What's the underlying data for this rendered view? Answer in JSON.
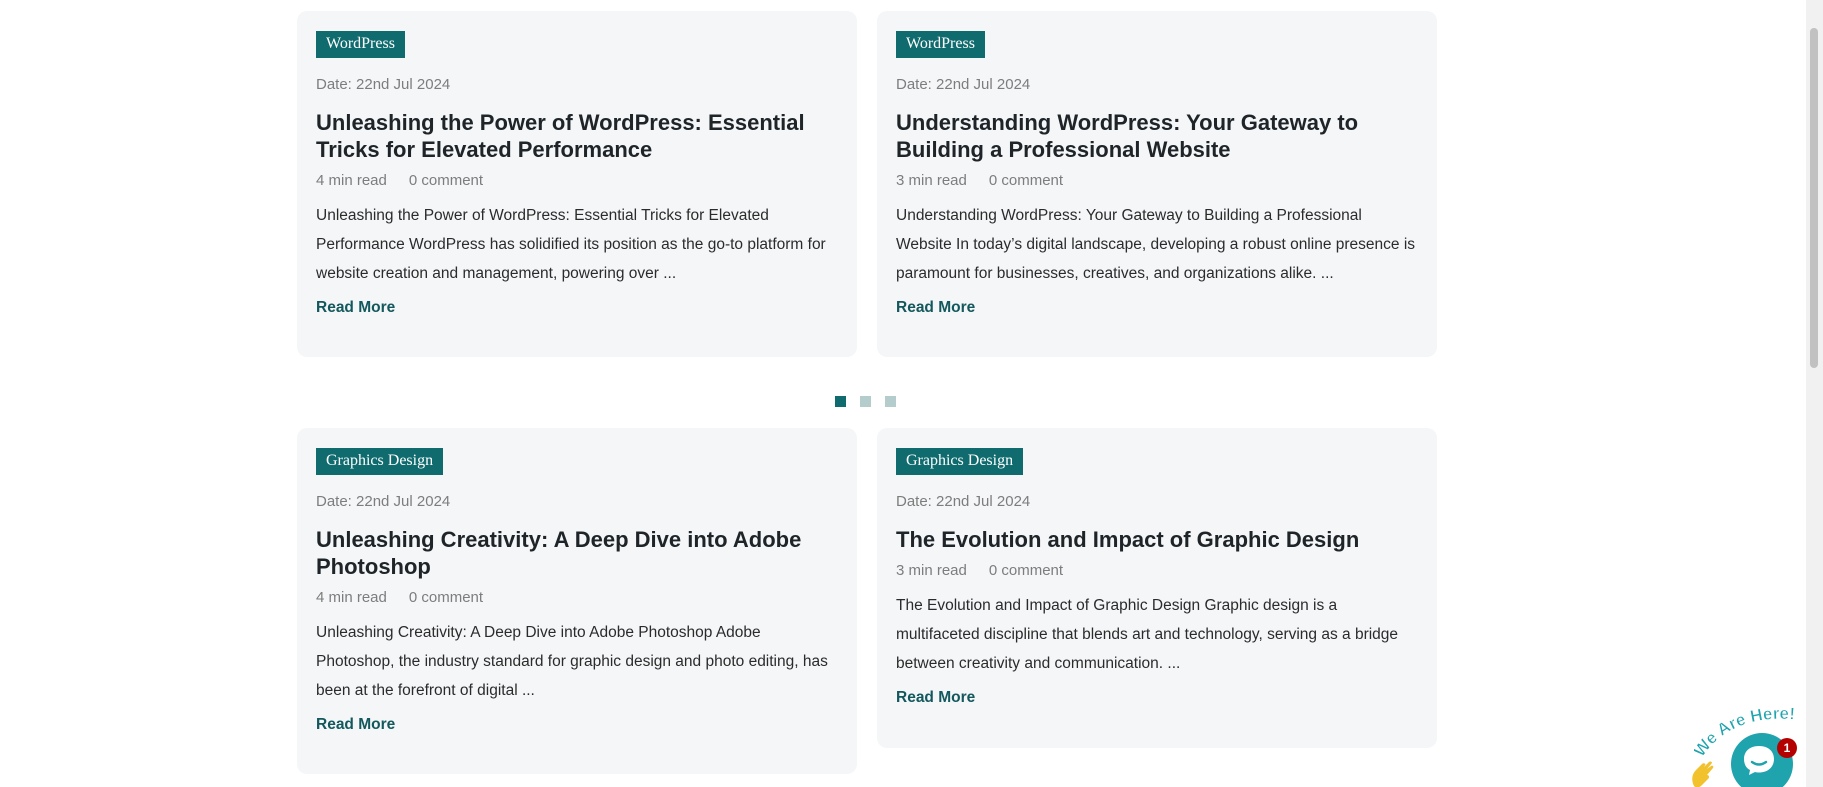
{
  "posts": [
    {
      "category": "WordPress",
      "date": "Date: 22nd Jul 2024",
      "title": "Unleashing the Power of WordPress: Essential Tricks for Elevated Performance",
      "read_time": "4 min read",
      "comments": "0 comment",
      "excerpt": "Unleashing the Power of WordPress: Essential Tricks for Elevated Performance WordPress has solidified its position as the go-to platform for website creation and management, powering over ...",
      "read_more": "Read More"
    },
    {
      "category": "WordPress",
      "date": "Date: 22nd Jul 2024",
      "title": "Understanding WordPress: Your Gateway to Building a Professional Website",
      "read_time": "3 min read",
      "comments": "0 comment",
      "excerpt": "Understanding WordPress: Your Gateway to Building a Professional Website In today’s digital landscape, developing a robust online presence is paramount for businesses, creatives, and organizations alike. ...",
      "read_more": "Read More"
    },
    {
      "category": "Graphics Design",
      "date": "Date: 22nd Jul 2024",
      "title": "Unleashing Creativity: A Deep Dive into Adobe Photoshop",
      "read_time": "4 min read",
      "comments": "0 comment",
      "excerpt": "Unleashing Creativity: A Deep Dive into Adobe Photoshop Adobe Photoshop, the industry standard for graphic design and photo editing, has been at the forefront of digital ...",
      "read_more": "Read More"
    },
    {
      "category": "Graphics Design",
      "date": "Date: 22nd Jul 2024",
      "title": "The Evolution and Impact of Graphic Design",
      "read_time": "3 min read",
      "comments": "0 comment",
      "excerpt": "The Evolution and Impact of Graphic Design Graphic design is a multifaceted discipline that blends art and technology, serving as a bridge between creativity and communication. ...",
      "read_more": "Read More"
    }
  ],
  "carousel": {
    "page_count": 3,
    "active_index": 0
  },
  "chat_widget": {
    "label": "We Are Here!",
    "unread_count": "1",
    "icon": "chat-bubble-icon"
  },
  "colors": {
    "accent": "#0f6b6e",
    "card_bg": "#f4f6f8",
    "link": "#13585c"
  }
}
